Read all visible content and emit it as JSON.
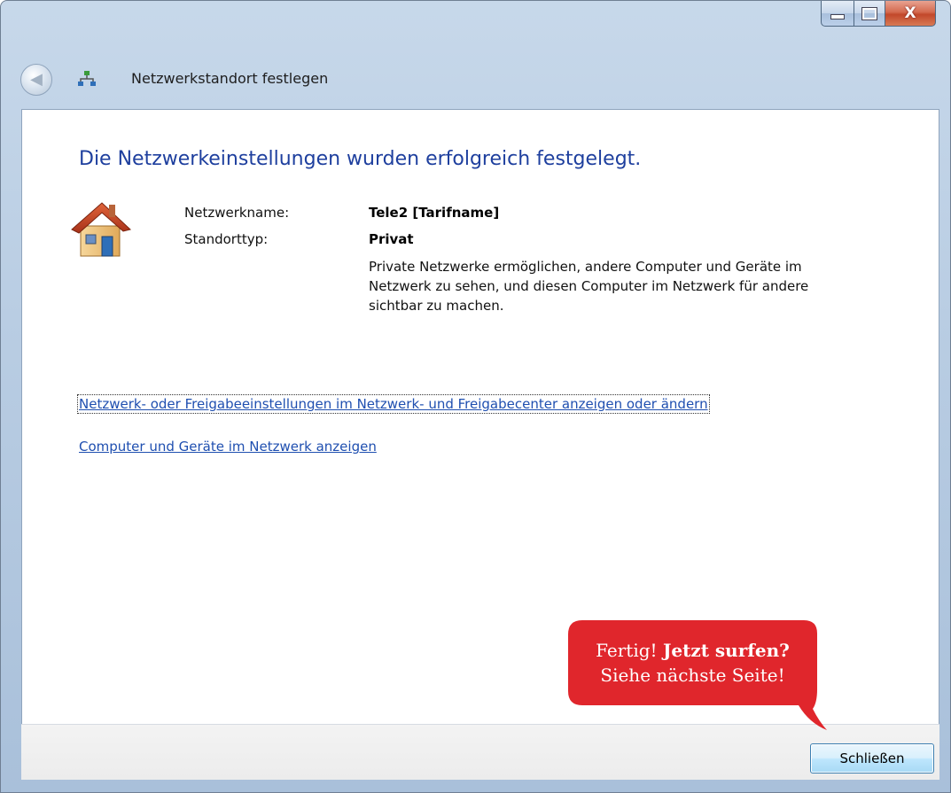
{
  "window": {
    "title": "Netzwerkstandort festlegen",
    "caption_buttons": {
      "close_glyph": "X"
    }
  },
  "main": {
    "heading": "Die Netzwerkeinstellungen wurden erfolgreich festgelegt.",
    "network_name_label": "Netzwerkname:",
    "network_name_value": "Tele2 [Tarifname]",
    "location_type_label": "Standorttyp:",
    "location_type_value": "Privat",
    "description": "Private Netzwerke ermöglichen, andere Computer und Geräte im Netzwerk zu sehen, und diesen Computer im Netzwerk für andere sichtbar zu machen.",
    "links": [
      "Netzwerk- oder Freigabeeinstellungen im Netzwerk- und Freigabecenter anzeigen oder ändern",
      "Computer und Geräte im Netzwerk anzeigen"
    ]
  },
  "footer": {
    "close_button_label": "Schließen"
  },
  "callout": {
    "line1_normal": "Fertig!",
    "line1_bold": "Jetzt surfen?",
    "line2": "Siehe nächste Seite!",
    "color": "#e0262c"
  },
  "icons": {
    "back": "back-arrow-icon",
    "network": "network-icon",
    "house": "house-icon"
  }
}
